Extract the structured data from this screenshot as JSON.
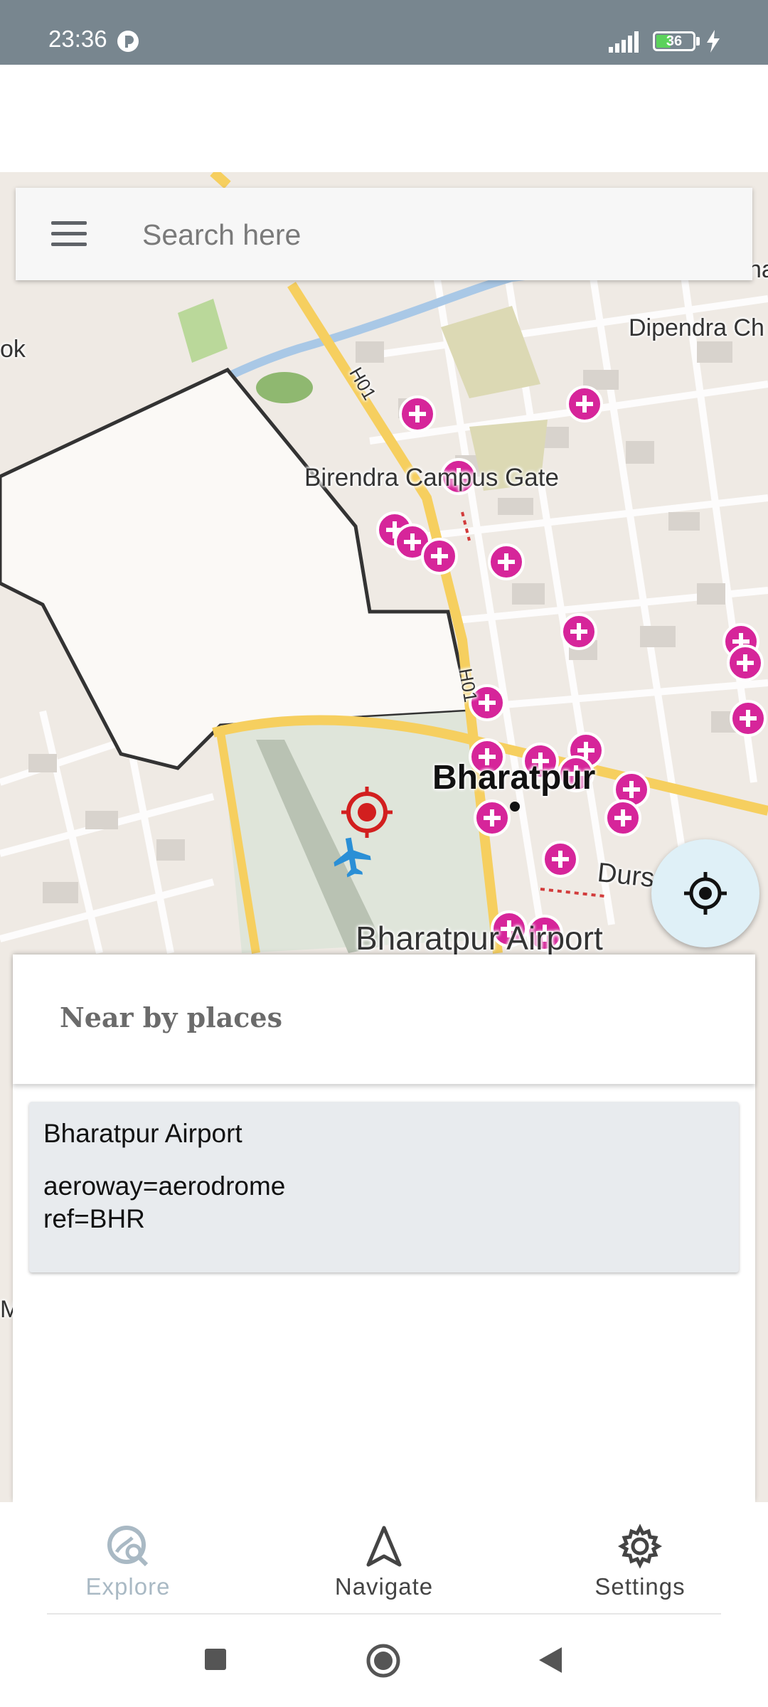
{
  "status_bar": {
    "time": "23:36",
    "battery_level": "36"
  },
  "search": {
    "placeholder": "Search here",
    "value": ""
  },
  "map": {
    "labels": {
      "birendra_campus_gate": "Birendra Campus Gate",
      "dipendra": "Dipendra Ch",
      "bharatpur": "Bharatpur",
      "bharatpur_airport": "Bharatpur Airport",
      "road_h01_a": "H01",
      "road_h01_b": "H01",
      "durs": "Durs",
      "ok": "ok",
      "na": "na",
      "edge_m": "M"
    },
    "colors": {
      "background": "#efeae4",
      "road_major": "#f6cf5f",
      "hospital": "#d6259a",
      "airport_icon": "#2a8fd6",
      "target_marker": "#d21f1f",
      "water": "#a9c8e6",
      "park": "#bad89a"
    }
  },
  "locate_button": {
    "icon": "crosshair-icon"
  },
  "nearby": {
    "title": "Near by places",
    "places": [
      {
        "name": "Bharatpur Airport",
        "tags": [
          "aeroway=aerodrome",
          "ref=BHR"
        ]
      }
    ]
  },
  "bottom_nav": {
    "items": [
      {
        "label": "Explore",
        "icon": "explore-icon",
        "active": true,
        "color": "#a9b9c4"
      },
      {
        "label": "Navigate",
        "icon": "navigate-icon",
        "active": false,
        "color": "#444444"
      },
      {
        "label": "Settings",
        "icon": "gear-icon",
        "active": false,
        "color": "#444444"
      }
    ]
  },
  "system_nav": {
    "buttons": [
      "recents-icon",
      "home-icon",
      "back-icon"
    ]
  }
}
